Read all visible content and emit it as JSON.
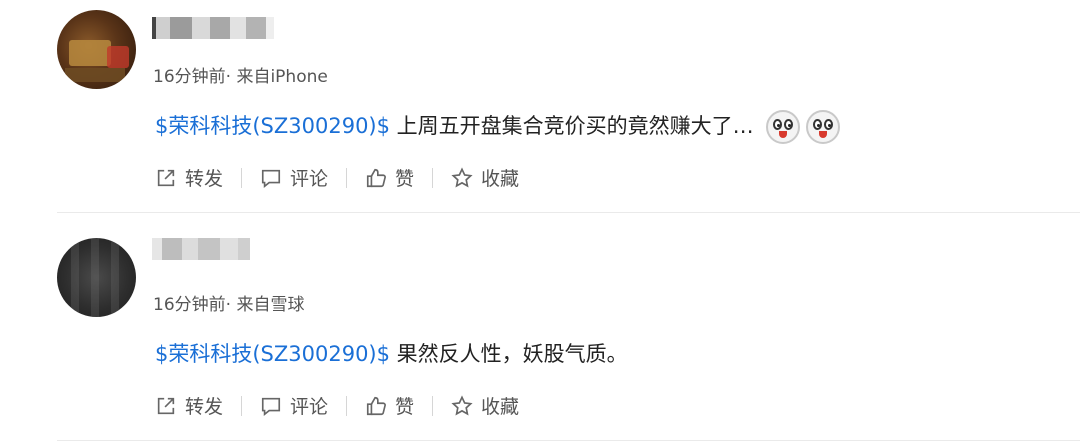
{
  "posts": [
    {
      "username": "",
      "meta": "16分钟前· 来自iPhone",
      "stock_tag": "$荣科科技(SZ300290)$",
      "text": " 上周五开盘集合竞价买的竟然赚大了…",
      "emojis": [
        "laughing-face-icon",
        "laughing-face-icon"
      ],
      "actions": {
        "repost": "转发",
        "comment": "评论",
        "like": "赞",
        "favorite": "收藏"
      }
    },
    {
      "username": "",
      "meta": "16分钟前· 来自雪球",
      "stock_tag": "$荣科科技(SZ300290)$",
      "text": " 果然反人性，妖股气质。",
      "emojis": [],
      "actions": {
        "repost": "转发",
        "comment": "评论",
        "like": "赞",
        "favorite": "收藏"
      }
    }
  ],
  "colors": {
    "stock_link": "#1a6fd6",
    "text": "#222222",
    "meta": "#555555",
    "divider": "#eaeaea"
  }
}
